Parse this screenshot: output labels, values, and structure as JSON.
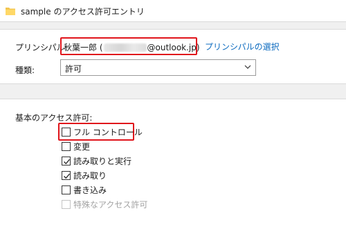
{
  "window": {
    "title": "sample のアクセス許可エントリ",
    "icon": "folder-icon"
  },
  "principal": {
    "label": "プリンシパル:",
    "value_prefix": "秋葉一郎 (",
    "value_suffix": "@outlook.jp)",
    "select_link": "プリンシパルの選択"
  },
  "type": {
    "label": "種類:",
    "value": "許可"
  },
  "permissions": {
    "title": "基本のアクセス許可:",
    "items": [
      {
        "label": "フル コントロール",
        "checked": false,
        "enabled": true
      },
      {
        "label": "変更",
        "checked": false,
        "enabled": true
      },
      {
        "label": "読み取りと実行",
        "checked": true,
        "enabled": true
      },
      {
        "label": "読み取り",
        "checked": true,
        "enabled": true
      },
      {
        "label": "書き込み",
        "checked": false,
        "enabled": true
      },
      {
        "label": "特殊なアクセス許可",
        "checked": false,
        "enabled": false
      }
    ]
  },
  "colors": {
    "highlight": "#e0141b",
    "link": "#0b6abf"
  }
}
